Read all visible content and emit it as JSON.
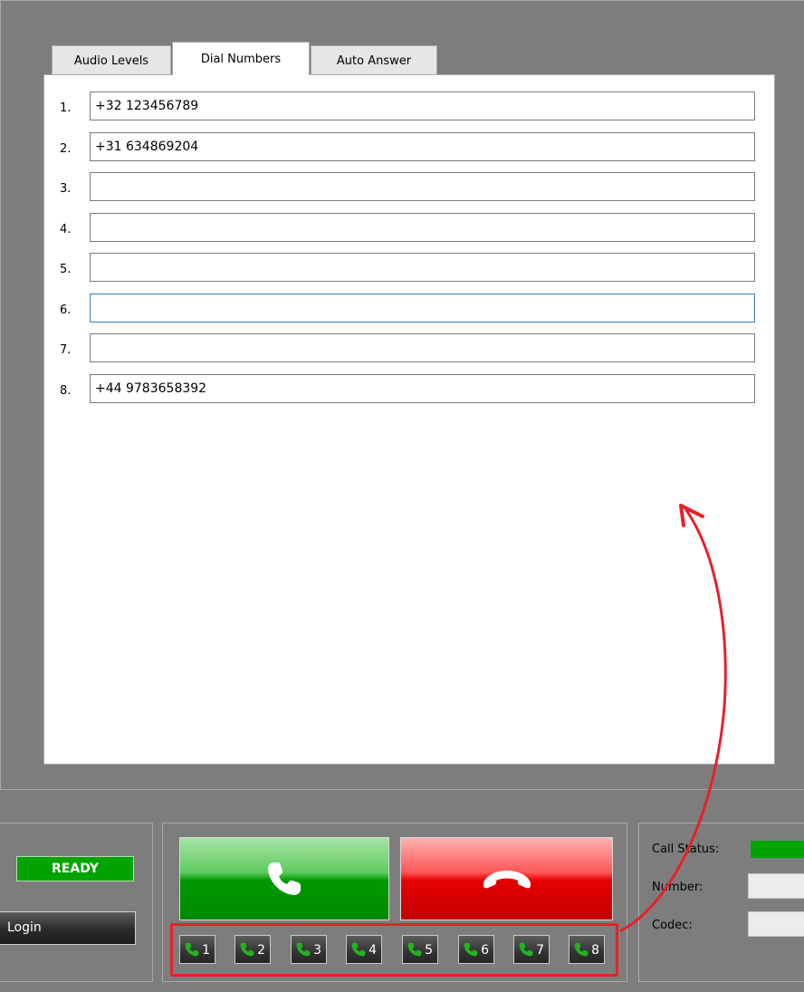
{
  "tabs": [
    {
      "label": "Audio Levels",
      "active": false
    },
    {
      "label": "Dial Numbers",
      "active": true
    },
    {
      "label": "Auto Answer",
      "active": false
    }
  ],
  "dial_numbers": [
    {
      "index": "1.",
      "value": "+32 123456789"
    },
    {
      "index": "2.",
      "value": "+31 634869204"
    },
    {
      "index": "3.",
      "value": ""
    },
    {
      "index": "4.",
      "value": ""
    },
    {
      "index": "5.",
      "value": ""
    },
    {
      "index": "6.",
      "value": "",
      "focused": true
    },
    {
      "index": "7.",
      "value": ""
    },
    {
      "index": "8.",
      "value": "+44 9783658392"
    }
  ],
  "status": {
    "ready_label": "READY",
    "ready_color": "#00a300"
  },
  "login_label": "Login",
  "call_button_icon": "phone-icon",
  "hangup_button_icon": "hangup-phone-icon",
  "speed_dial": [
    "1",
    "2",
    "3",
    "4",
    "5",
    "6",
    "7",
    "8"
  ],
  "call_info": {
    "call_status_label": "Call Status:",
    "number_label": "Number:",
    "codec_label": "Codec:",
    "call_status_color": "#00a300"
  },
  "annotation": {
    "highlight_color": "#e8202a",
    "arrow_icon": "curved-arrow"
  }
}
